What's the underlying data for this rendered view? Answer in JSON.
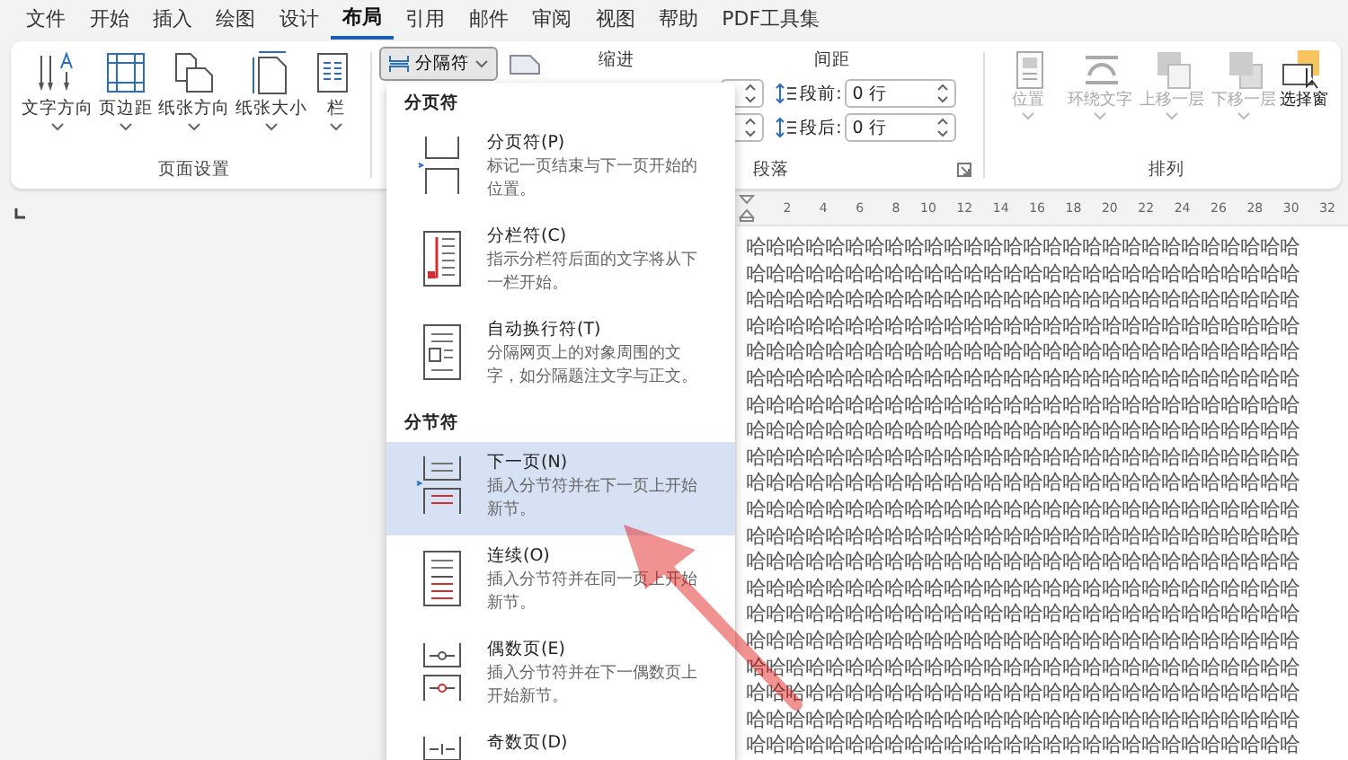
{
  "menu_tabs": [
    {
      "label": "文件",
      "selected": false
    },
    {
      "label": "开始",
      "selected": false
    },
    {
      "label": "插入",
      "selected": false
    },
    {
      "label": "绘图",
      "selected": false
    },
    {
      "label": "设计",
      "selected": false
    },
    {
      "label": "布局",
      "selected": true
    },
    {
      "label": "引用",
      "selected": false
    },
    {
      "label": "邮件",
      "selected": false
    },
    {
      "label": "审阅",
      "selected": false
    },
    {
      "label": "视图",
      "selected": false
    },
    {
      "label": "帮助",
      "selected": false
    },
    {
      "label": "PDF工具集",
      "selected": false
    }
  ],
  "page_setup": {
    "buttons": [
      {
        "label": "文字方向"
      },
      {
        "label": "页边距"
      },
      {
        "label": "纸张方向"
      },
      {
        "label": "纸张大小"
      },
      {
        "label": "栏"
      }
    ],
    "group_label": "页面设置"
  },
  "paragraph": {
    "breaks_button": {
      "label": "分隔符",
      "expanded": true
    },
    "indent_label": "缩进",
    "spacing_label": "间距",
    "spacing_fields": [
      {
        "label": "段前:",
        "value": "0 行"
      },
      {
        "label": "段后:",
        "value": "0 行"
      }
    ],
    "group_label": "段落"
  },
  "arrange": {
    "buttons": [
      {
        "label": "位置",
        "disabled": true
      },
      {
        "label": "环绕文字",
        "disabled": true
      },
      {
        "label": "上移一层",
        "disabled": true
      },
      {
        "label": "下移一层",
        "disabled": true
      },
      {
        "label": "选择窗",
        "disabled": false
      }
    ],
    "group_label": "排列"
  },
  "ruler": {
    "ticks": [
      "2",
      "4",
      "6",
      "8",
      "10",
      "12",
      "14",
      "16",
      "18",
      "20",
      "22",
      "24",
      "26",
      "28",
      "30",
      "32"
    ]
  },
  "document": {
    "lines": [
      "哈哈哈哈哈哈哈哈哈哈哈哈哈哈哈哈哈哈哈哈哈哈哈哈哈哈哈哈",
      "哈哈哈哈哈哈哈哈哈哈哈哈哈哈哈哈哈哈哈哈哈哈哈哈哈哈哈哈",
      "哈哈哈哈哈哈哈哈哈哈哈哈哈哈哈哈哈哈哈哈哈哈哈哈哈哈哈哈",
      "哈哈哈哈哈哈哈哈哈哈哈哈哈哈哈哈哈哈哈哈哈哈哈哈哈哈哈哈",
      "哈哈哈哈哈哈哈哈哈哈哈哈哈哈哈哈哈哈哈哈哈哈哈哈哈哈哈哈",
      "哈哈哈哈哈哈哈哈哈哈哈哈哈哈哈哈哈哈哈哈哈哈哈哈哈哈哈哈",
      "哈哈哈哈哈哈哈哈哈哈哈哈哈哈哈哈哈哈哈哈哈哈哈哈哈哈哈哈",
      "哈哈哈哈哈哈哈哈哈哈哈哈哈哈哈哈哈哈哈哈哈哈哈哈哈哈哈哈",
      "哈哈哈哈哈哈哈哈哈哈哈哈哈哈哈哈哈哈哈哈哈哈哈哈哈哈哈哈",
      "哈哈哈哈哈哈哈哈哈哈哈哈哈哈哈哈哈哈哈哈哈哈哈哈哈哈哈哈",
      "哈哈哈哈哈哈哈哈哈哈哈哈哈哈哈哈哈哈哈哈哈哈哈哈哈哈哈哈",
      "哈哈哈哈哈哈哈哈哈哈哈哈哈哈哈哈哈哈哈哈哈哈哈哈哈哈哈哈",
      "哈哈哈哈哈哈哈哈哈哈哈哈哈哈哈哈哈哈哈哈哈哈哈哈哈哈哈哈",
      "哈哈哈哈哈哈哈哈哈哈哈哈哈哈哈哈哈哈哈哈哈哈哈哈哈哈哈哈",
      "哈哈哈哈哈哈哈哈哈哈哈哈哈哈哈哈哈哈哈哈哈哈哈哈哈哈哈哈",
      "哈哈哈哈哈哈哈哈哈哈哈哈哈哈哈哈哈哈哈哈哈哈哈哈哈哈哈哈",
      "哈哈哈哈哈哈哈哈哈哈哈哈哈哈哈哈哈哈哈哈哈哈哈哈哈哈哈哈",
      "哈哈哈哈哈哈哈哈哈哈哈哈哈哈哈哈哈哈哈哈哈哈哈哈哈哈哈哈",
      "哈哈哈哈哈哈哈哈哈哈哈哈哈哈哈哈哈哈哈哈哈哈哈哈哈哈哈哈",
      "哈哈哈哈哈哈哈哈哈哈哈哈哈哈哈哈哈哈哈哈哈哈哈哈哈哈哈哈"
    ]
  },
  "breaks_menu": {
    "sections": [
      {
        "title": "分页符",
        "items": [
          {
            "title": "分页符(P)",
            "description": "标记一页结束与下一页开始的位置。",
            "selected": false
          },
          {
            "title": "分栏符(C)",
            "description": "指示分栏符后面的文字将从下一栏开始。",
            "selected": false
          },
          {
            "title": "自动换行符(T)",
            "description": "分隔网页上的对象周围的文字，如分隔题注文字与正文。",
            "selected": false
          }
        ]
      },
      {
        "title": "分节符",
        "items": [
          {
            "title": "下一页(N)",
            "description": "插入分节符并在下一页上开始新节。",
            "selected": true
          },
          {
            "title": "连续(O)",
            "description": "插入分节符并在同一页上开始新节。",
            "selected": false
          },
          {
            "title": "偶数页(E)",
            "description": "插入分节符并在下一偶数页上开始新节。",
            "selected": false
          },
          {
            "title": "奇数页(D)",
            "selected": false
          }
        ]
      }
    ]
  }
}
